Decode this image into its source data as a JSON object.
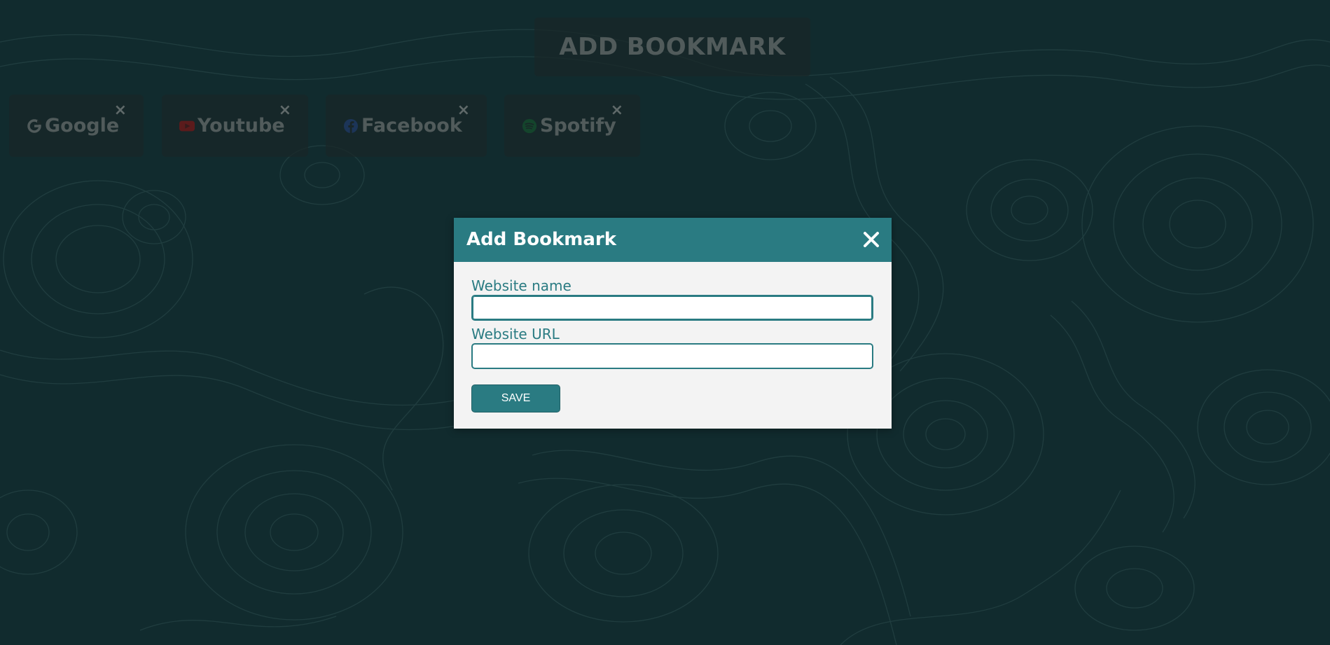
{
  "header": {
    "add_bookmark_label": "ADD BOOKMARK"
  },
  "bookmarks": [
    {
      "name": "Google",
      "icon": "google-icon",
      "close": "×"
    },
    {
      "name": "Youtube",
      "icon": "youtube-icon",
      "close": "×"
    },
    {
      "name": "Facebook",
      "icon": "facebook-icon",
      "close": "×"
    },
    {
      "name": "Spotify",
      "icon": "spotify-icon",
      "close": "×"
    }
  ],
  "modal": {
    "title": "Add Bookmark",
    "close_icon": "close-icon",
    "name_label": "Website name",
    "name_value": "",
    "url_label": "Website URL",
    "url_value": "",
    "save_label": "SAVE"
  },
  "colors": {
    "accent": "#2a7b82",
    "background": "#1a3d40",
    "card": "#283434"
  }
}
